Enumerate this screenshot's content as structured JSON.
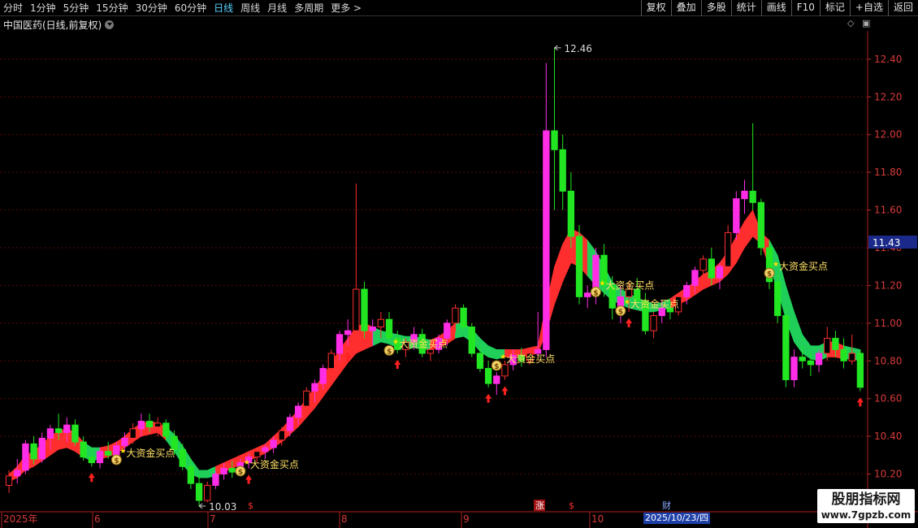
{
  "toolbar": {
    "periods": [
      "分时",
      "1分钟",
      "5分钟",
      "15分钟",
      "30分钟",
      "60分钟",
      "日线",
      "周线",
      "月线",
      "多周期",
      "更多 >"
    ],
    "active_period": "日线",
    "buttons": [
      "复权",
      "叠加",
      "多股",
      "统计",
      "画线",
      "F10",
      "标记",
      "+自选",
      "返回"
    ]
  },
  "title": "中国医药(日线,前复权)",
  "price_axis": {
    "ticks": [
      "12.40",
      "12.20",
      "12.00",
      "11.80",
      "11.60",
      "11.40",
      "11.20",
      "11.00",
      "10.80",
      "10.60",
      "10.40",
      "10.20"
    ],
    "current_price": "11.43"
  },
  "annotations": {
    "high_label": "12.46",
    "low_label": "10.03",
    "signal_label": "大资金买点"
  },
  "markers": {
    "s": "$",
    "zhang": "涨",
    "cai": "财"
  },
  "time_axis": {
    "labels": [
      "2025年",
      "6",
      "7",
      "8",
      "9",
      "10"
    ],
    "cursor_date": "2025/10/23/四"
  },
  "watermark": {
    "line1": "股朋指标网",
    "line2": "www.7gpzb.com"
  },
  "colors": {
    "up": "#ff2e2e",
    "magenta": "#ff2ee6",
    "down": "#22e622",
    "band_green": "#1fcf5a"
  },
  "chart_data": {
    "type": "candlestick",
    "ylim": [
      10.0,
      12.55
    ],
    "candles": [
      [
        10.14,
        10.22,
        10.1,
        10.19
      ],
      [
        10.19,
        10.28,
        10.15,
        10.22
      ],
      [
        10.22,
        10.38,
        10.2,
        10.36
      ],
      [
        10.36,
        10.4,
        10.25,
        10.28
      ],
      [
        10.28,
        10.42,
        10.26,
        10.39
      ],
      [
        10.39,
        10.46,
        10.33,
        10.44
      ],
      [
        10.44,
        10.52,
        10.38,
        10.42
      ],
      [
        10.42,
        10.5,
        10.37,
        10.46
      ],
      [
        10.46,
        10.49,
        10.35,
        10.37
      ],
      [
        10.37,
        10.4,
        10.27,
        10.29
      ],
      [
        10.29,
        10.34,
        10.24,
        10.26
      ],
      [
        10.26,
        10.34,
        10.23,
        10.32
      ],
      [
        10.32,
        10.37,
        10.28,
        10.3
      ],
      [
        10.3,
        10.37,
        10.27,
        10.35
      ],
      [
        10.35,
        10.42,
        10.32,
        10.39
      ],
      [
        10.39,
        10.47,
        10.36,
        10.44
      ],
      [
        10.44,
        10.52,
        10.4,
        10.48
      ],
      [
        10.48,
        10.52,
        10.42,
        10.45
      ],
      [
        10.45,
        10.5,
        10.4,
        10.47
      ],
      [
        10.47,
        10.49,
        10.38,
        10.4
      ],
      [
        10.4,
        10.43,
        10.3,
        10.33
      ],
      [
        10.33,
        10.36,
        10.22,
        10.24
      ],
      [
        10.24,
        10.28,
        10.12,
        10.15
      ],
      [
        10.15,
        10.2,
        10.03,
        10.06
      ],
      [
        10.06,
        10.16,
        10.05,
        10.14
      ],
      [
        10.14,
        10.22,
        10.12,
        10.2
      ],
      [
        10.2,
        10.26,
        10.17,
        10.23
      ],
      [
        10.23,
        10.27,
        10.18,
        10.21
      ],
      [
        10.21,
        10.28,
        10.19,
        10.26
      ],
      [
        10.26,
        10.31,
        10.23,
        10.29
      ],
      [
        10.29,
        10.34,
        10.26,
        10.32
      ],
      [
        10.32,
        10.36,
        10.28,
        10.34
      ],
      [
        10.34,
        10.4,
        10.31,
        10.38
      ],
      [
        10.38,
        10.45,
        10.35,
        10.43
      ],
      [
        10.43,
        10.52,
        10.4,
        10.5
      ],
      [
        10.5,
        10.58,
        10.46,
        10.56
      ],
      [
        10.56,
        10.66,
        10.52,
        10.64
      ],
      [
        10.64,
        10.7,
        10.58,
        10.68
      ],
      [
        10.68,
        10.78,
        10.65,
        10.76
      ],
      [
        10.76,
        10.86,
        10.72,
        10.84
      ],
      [
        10.84,
        10.96,
        10.8,
        10.94
      ],
      [
        10.94,
        11.02,
        10.88,
        10.96
      ],
      [
        10.96,
        11.74,
        10.9,
        11.18
      ],
      [
        11.18,
        11.22,
        10.92,
        10.96
      ],
      [
        10.96,
        11.02,
        10.88,
        10.98
      ],
      [
        10.98,
        11.06,
        10.92,
        11.02
      ],
      [
        11.02,
        11.06,
        10.9,
        10.92
      ],
      [
        10.92,
        10.96,
        10.84,
        10.86
      ],
      [
        10.86,
        10.92,
        10.82,
        10.9
      ],
      [
        10.9,
        10.98,
        10.86,
        10.94
      ],
      [
        10.94,
        10.97,
        10.82,
        10.84
      ],
      [
        10.84,
        10.9,
        10.8,
        10.86
      ],
      [
        10.86,
        10.94,
        10.84,
        10.92
      ],
      [
        10.92,
        11.02,
        10.88,
        11.0
      ],
      [
        11.0,
        11.1,
        10.95,
        11.08
      ],
      [
        11.08,
        11.1,
        10.96,
        10.98
      ],
      [
        10.98,
        11.0,
        10.82,
        10.84
      ],
      [
        10.84,
        10.88,
        10.74,
        10.76
      ],
      [
        10.76,
        10.8,
        10.66,
        10.68
      ],
      [
        10.68,
        10.74,
        10.62,
        10.72
      ],
      [
        10.72,
        10.8,
        10.7,
        10.78
      ],
      [
        10.78,
        10.86,
        10.75,
        10.83
      ],
      [
        10.83,
        10.87,
        10.77,
        10.8
      ],
      [
        10.8,
        10.86,
        10.78,
        10.84
      ],
      [
        10.84,
        11.06,
        10.82,
        10.86
      ],
      [
        10.86,
        12.38,
        10.82,
        12.02
      ],
      [
        12.02,
        12.46,
        11.6,
        11.92
      ],
      [
        11.92,
        12.0,
        11.6,
        11.7
      ],
      [
        11.7,
        11.8,
        11.4,
        11.46
      ],
      [
        11.46,
        11.52,
        11.1,
        11.14
      ],
      [
        11.14,
        11.2,
        11.08,
        11.16
      ],
      [
        11.16,
        11.4,
        11.1,
        11.36
      ],
      [
        11.36,
        11.42,
        11.14,
        11.2
      ],
      [
        11.2,
        11.25,
        11.02,
        11.08
      ],
      [
        11.08,
        11.2,
        11.0,
        11.14
      ],
      [
        11.14,
        11.22,
        11.06,
        11.18
      ],
      [
        11.18,
        11.24,
        11.1,
        11.12
      ],
      [
        11.12,
        11.16,
        10.94,
        10.96
      ],
      [
        10.96,
        11.06,
        10.92,
        11.04
      ],
      [
        11.04,
        11.12,
        11.0,
        11.08
      ],
      [
        11.08,
        11.12,
        11.02,
        11.06
      ],
      [
        11.06,
        11.16,
        11.04,
        11.14
      ],
      [
        11.14,
        11.22,
        11.1,
        11.2
      ],
      [
        11.2,
        11.3,
        11.16,
        11.28
      ],
      [
        11.28,
        11.36,
        11.22,
        11.34
      ],
      [
        11.34,
        11.4,
        11.2,
        11.24
      ],
      [
        11.24,
        11.32,
        11.18,
        11.3
      ],
      [
        11.3,
        11.52,
        11.26,
        11.48
      ],
      [
        11.48,
        11.7,
        11.44,
        11.66
      ],
      [
        11.66,
        11.76,
        11.58,
        11.7
      ],
      [
        11.7,
        12.06,
        11.6,
        11.64
      ],
      [
        11.64,
        11.66,
        11.36,
        11.4
      ],
      [
        11.4,
        11.44,
        11.18,
        11.22
      ],
      [
        11.22,
        11.26,
        11.0,
        11.04
      ],
      [
        11.04,
        11.08,
        10.66,
        10.7
      ],
      [
        10.7,
        10.86,
        10.66,
        10.82
      ],
      [
        10.82,
        10.88,
        10.76,
        10.8
      ],
      [
        10.8,
        10.84,
        10.72,
        10.78
      ],
      [
        10.78,
        10.86,
        10.74,
        10.84
      ],
      [
        10.84,
        10.98,
        10.8,
        10.92
      ],
      [
        10.92,
        10.96,
        10.82,
        10.86
      ],
      [
        10.86,
        10.92,
        10.76,
        10.8
      ],
      [
        10.8,
        10.94,
        10.78,
        10.84
      ],
      [
        10.84,
        10.86,
        10.64,
        10.66
      ]
    ],
    "band": [
      [
        10.16,
        10.2
      ],
      [
        10.18,
        10.24
      ],
      [
        10.22,
        10.3
      ],
      [
        10.24,
        10.32
      ],
      [
        10.27,
        10.36
      ],
      [
        10.3,
        10.4
      ],
      [
        10.33,
        10.43
      ],
      [
        10.34,
        10.44
      ],
      [
        10.32,
        10.42
      ],
      [
        10.29,
        10.37
      ],
      [
        10.27,
        10.34
      ],
      [
        10.28,
        10.34
      ],
      [
        10.29,
        10.35
      ],
      [
        10.31,
        10.37
      ],
      [
        10.34,
        10.4
      ],
      [
        10.37,
        10.44
      ],
      [
        10.4,
        10.47
      ],
      [
        10.41,
        10.48
      ],
      [
        10.42,
        10.47
      ],
      [
        10.38,
        10.45
      ],
      [
        10.32,
        10.41
      ],
      [
        10.25,
        10.35
      ],
      [
        10.2,
        10.28
      ],
      [
        10.18,
        10.22
      ],
      [
        10.18,
        10.22
      ],
      [
        10.19,
        10.24
      ],
      [
        10.21,
        10.26
      ],
      [
        10.23,
        10.28
      ],
      [
        10.25,
        10.3
      ],
      [
        10.27,
        10.32
      ],
      [
        10.29,
        10.34
      ],
      [
        10.31,
        10.36
      ],
      [
        10.34,
        10.4
      ],
      [
        10.37,
        10.44
      ],
      [
        10.41,
        10.49
      ],
      [
        10.45,
        10.54
      ],
      [
        10.5,
        10.6
      ],
      [
        10.55,
        10.66
      ],
      [
        10.61,
        10.72
      ],
      [
        10.67,
        10.79
      ],
      [
        10.73,
        10.86
      ],
      [
        10.79,
        10.92
      ],
      [
        10.84,
        10.98
      ],
      [
        10.86,
        11.0
      ],
      [
        10.88,
        10.98
      ],
      [
        10.9,
        10.96
      ],
      [
        10.89,
        10.95
      ],
      [
        10.87,
        10.94
      ],
      [
        10.86,
        10.93
      ],
      [
        10.87,
        10.93
      ],
      [
        10.86,
        10.92
      ],
      [
        10.86,
        10.91
      ],
      [
        10.87,
        10.93
      ],
      [
        10.89,
        10.96
      ],
      [
        10.92,
        11.0
      ],
      [
        10.93,
        11.0
      ],
      [
        10.9,
        10.97
      ],
      [
        10.85,
        10.92
      ],
      [
        10.82,
        10.88
      ],
      [
        10.81,
        10.86
      ],
      [
        10.82,
        10.86
      ],
      [
        10.82,
        10.86
      ],
      [
        10.82,
        10.86
      ],
      [
        10.83,
        10.87
      ],
      [
        10.84,
        10.88
      ],
      [
        10.95,
        11.1
      ],
      [
        11.1,
        11.3
      ],
      [
        11.22,
        11.42
      ],
      [
        11.32,
        11.5
      ],
      [
        11.3,
        11.48
      ],
      [
        11.25,
        11.44
      ],
      [
        11.2,
        11.38
      ],
      [
        11.16,
        11.3
      ],
      [
        11.12,
        11.22
      ],
      [
        11.1,
        11.18
      ],
      [
        11.08,
        11.16
      ],
      [
        11.07,
        11.13
      ],
      [
        11.06,
        11.12
      ],
      [
        11.06,
        11.1
      ],
      [
        11.07,
        11.11
      ],
      [
        11.08,
        11.13
      ],
      [
        11.1,
        11.16
      ],
      [
        11.12,
        11.19
      ],
      [
        11.15,
        11.22
      ],
      [
        11.18,
        11.26
      ],
      [
        11.2,
        11.28
      ],
      [
        11.22,
        11.32
      ],
      [
        11.26,
        11.38
      ],
      [
        11.32,
        11.46
      ],
      [
        11.4,
        11.54
      ],
      [
        11.46,
        11.6
      ],
      [
        11.42,
        11.48
      ],
      [
        11.3,
        11.44
      ],
      [
        11.18,
        11.36
      ],
      [
        11.02,
        11.2
      ],
      [
        10.9,
        11.06
      ],
      [
        10.84,
        10.94
      ],
      [
        10.81,
        10.88
      ],
      [
        10.8,
        10.88
      ],
      [
        10.82,
        10.9
      ],
      [
        10.82,
        10.9
      ],
      [
        10.81,
        10.88
      ],
      [
        10.81,
        10.87
      ],
      [
        10.8,
        10.86
      ]
    ],
    "band_color_seq": "rrrrrrrrrggrrrrrrrrggggggrrrrrrrrrrrrrrrrrrrgggggggrrrggggggrrrrrrrrrrggggggggggrrrrrrrrrrrrgggggggrrgg",
    "signals": [
      13,
      28,
      46,
      59,
      71,
      74,
      92,
      113
    ],
    "up_arrows": [
      10,
      29,
      41,
      47,
      58,
      60,
      75,
      103,
      107,
      113
    ],
    "low_index": 23,
    "high_index": 66
  }
}
